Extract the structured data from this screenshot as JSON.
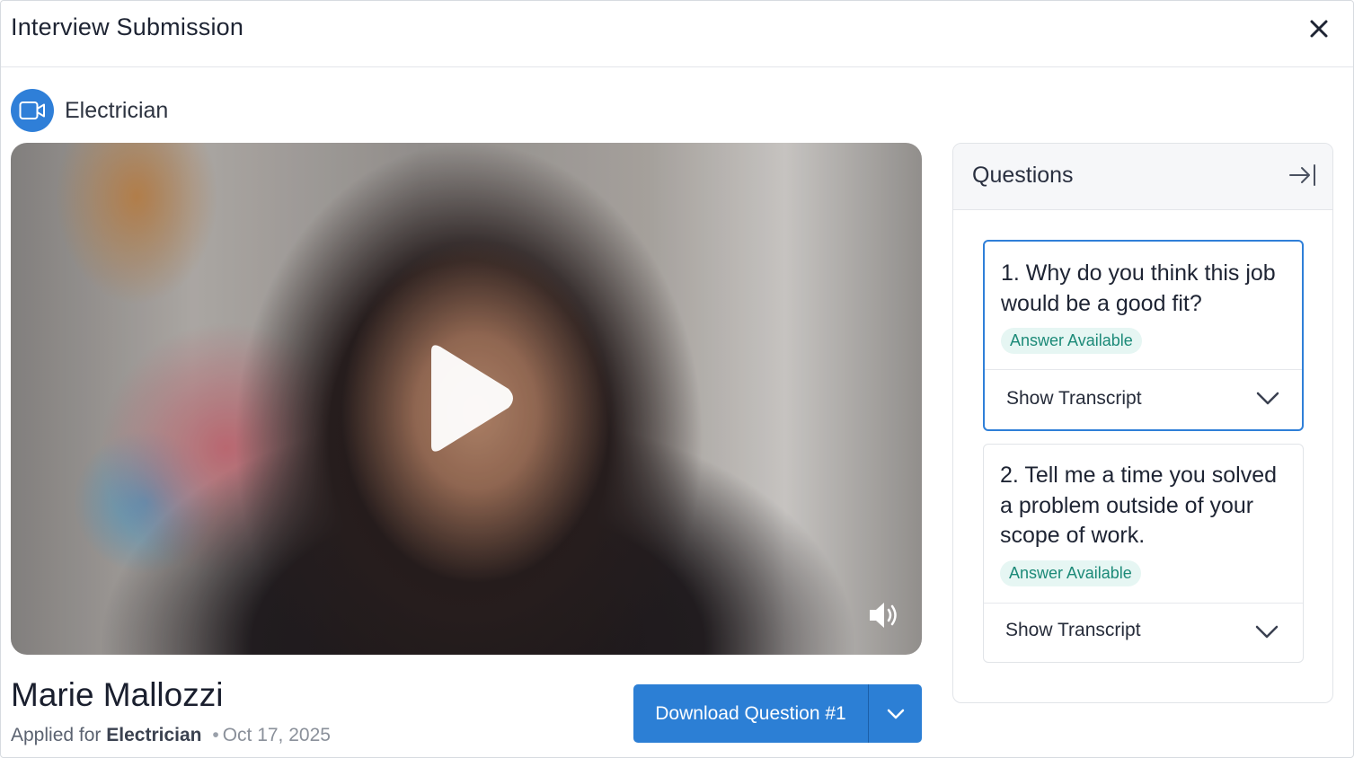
{
  "header": {
    "title": "Interview Submission",
    "close_icon": "close-icon"
  },
  "role": {
    "label": "Electrician",
    "icon": "video-camera-icon",
    "icon_bg": "#2f7fd8"
  },
  "video": {
    "play_icon": "play-icon",
    "volume_icon": "volume-icon"
  },
  "candidate": {
    "name": "Marie Mallozzi",
    "applied_prefix": "Applied for",
    "applied_role": "Electrician",
    "separator": "•",
    "date": "Oct 17, 2025"
  },
  "download": {
    "label": "Download Question #1",
    "toggle_icon": "chevron-down-icon",
    "color": "#2c7fd5"
  },
  "questions": {
    "title": "Questions",
    "collapse_icon": "collapse-right-icon",
    "items": [
      {
        "text": "1. Why do you think this job would be a good fit?",
        "badge": "Answer Available",
        "transcript_label": "Show Transcript",
        "active": true
      },
      {
        "text": "2. Tell me a time you solved a problem outside of your scope of work.",
        "badge": "Answer Available",
        "transcript_label": "Show Transcript",
        "active": false
      }
    ]
  },
  "colors": {
    "accent": "#2f7fd8",
    "badge_bg": "#e6f6f3",
    "badge_text": "#1c8a78"
  }
}
